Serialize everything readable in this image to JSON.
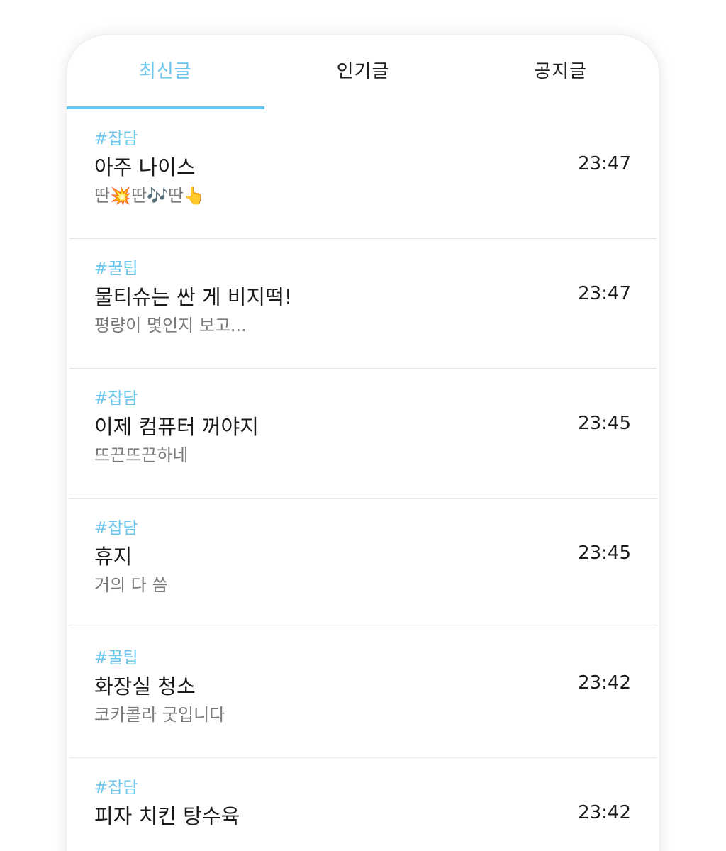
{
  "tabs": [
    {
      "label": "최신글",
      "active": true
    },
    {
      "label": "인기글",
      "active": false
    },
    {
      "label": "공지글",
      "active": false
    }
  ],
  "accent_color": "#6bc6ee",
  "posts": [
    {
      "tag": "#잡담",
      "title": "아주 나이스",
      "preview": "딴💥딴🎶딴👆",
      "time": "23:47"
    },
    {
      "tag": "#꿀팁",
      "title": "물티슈는 싼 게 비지떡!",
      "preview": "평량이 몇인지 보고...",
      "time": "23:47"
    },
    {
      "tag": "#잡담",
      "title": "이제 컴퓨터 꺼야지",
      "preview": "뜨끈뜨끈하네",
      "time": "23:45"
    },
    {
      "tag": "#잡담",
      "title": "휴지",
      "preview": "거의 다 씀",
      "time": "23:45"
    },
    {
      "tag": "#꿀팁",
      "title": "화장실 청소",
      "preview": "코카콜라 굿입니다",
      "time": "23:42"
    },
    {
      "tag": "#잡담",
      "title": "피자 치킨 탕수육",
      "preview": "",
      "time": "23:42"
    }
  ]
}
